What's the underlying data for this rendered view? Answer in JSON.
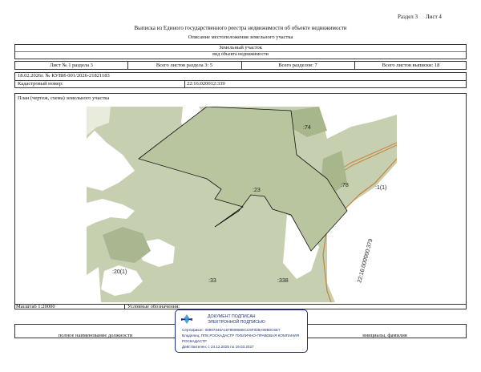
{
  "header": {
    "section_label": "Раздел 3",
    "sheet_label": "Лист 4",
    "title": "Выписка из Единого государственного реестра недвижимости об объекте недвижимости",
    "subtitle": "Описание местоположения земельного участка"
  },
  "object_block": {
    "object_type": "Земельный участок",
    "object_type_caption": "вид объекта недвижимости"
  },
  "sheet_row": {
    "sheet_in_section": "Лист № 1 раздела 3",
    "sheets_in_section": "Всего листов раздела 3: 5",
    "sections_total": "Всего разделов: 7",
    "sheets_total": "Всего листов выписки: 18"
  },
  "doc_row": {
    "doc_date_number": "18.02.2026г. № КУВИ-001/2026-21821183",
    "cadastral_label": "Кадастровый номер:",
    "cadastral_value": "22:16:020012:339"
  },
  "plan": {
    "caption": "План (чертеж, схема) земельного участка",
    "labels": {
      "l74": ":74",
      "l23": ":23",
      "l78": ":78",
      "l1": ":1(1)",
      "l20": ":20(1)",
      "l33": ":33",
      "l338": ":338",
      "road": "22:16:000000:379"
    }
  },
  "scale_row": {
    "scale": "Масштаб 1:20000",
    "legend": "Условные обозначения:"
  },
  "signature_row": {
    "position": "полное наименование должности",
    "name": "инициалы, фамилия"
  },
  "stamp": {
    "line1": "ДОКУМЕНТ ПОДПИСАН",
    "line2": "ЭЛЕКТРОННОЙ ПОДПИСЬЮ",
    "cert": "Сертификат: 00997346A1679599686CC5F039A90B0C6E7",
    "owner": "Владелец: ППК РОСКАДАСТР ПУБЛИЧНО-ПРАВОВАЯ КОМПАНИЯ",
    "owner2": "РОСКАДАСТР",
    "valid": "Действителен: с 24.12.2025 по 19.03.2027"
  },
  "colors": {
    "parcel_fill": "#b9c59f",
    "background_land": "#c6d0b0",
    "white_area": "#ffffff",
    "road_line": "#c8823c",
    "stamp_border": "#1e2f7a"
  }
}
